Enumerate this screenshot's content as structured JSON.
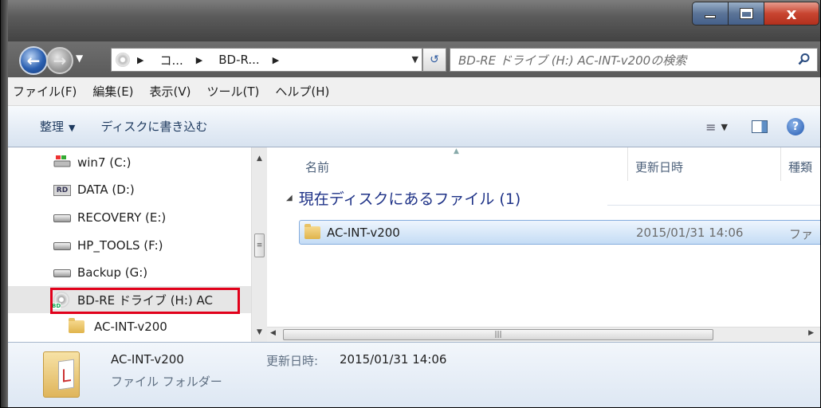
{
  "window": {
    "minimize_glyph": "—",
    "maximize_glyph": "□",
    "close_glyph": "x"
  },
  "address_bar": {
    "crumbs": [
      "コ...",
      "BD-R...",
      ""
    ],
    "search_placeholder": "BD-RE ドライブ (H:) AC-INT-v200の検索"
  },
  "menu": {
    "items": [
      "ファイル(F)",
      "編集(E)",
      "表示(V)",
      "ツール(T)",
      "ヘルプ(H)"
    ]
  },
  "toolbar": {
    "organize": "整理",
    "burn": "ディスクに書き込む"
  },
  "nav_tree": {
    "items": [
      {
        "label": "win7 (C:)",
        "icon": "windows-drive-icon"
      },
      {
        "label": "DATA (D:)",
        "icon": "data-drive-icon"
      },
      {
        "label": "RECOVERY (E:)",
        "icon": "hard-drive-icon"
      },
      {
        "label": "HP_TOOLS (F:)",
        "icon": "hard-drive-icon"
      },
      {
        "label": "Backup (G:)",
        "icon": "hard-drive-icon"
      },
      {
        "label": "BD-RE ドライブ (H:) AC",
        "icon": "bd-drive-icon",
        "selected": true
      },
      {
        "label": "AC-INT-v200",
        "icon": "folder-icon"
      }
    ]
  },
  "content": {
    "columns": {
      "name": "名前",
      "modified": "更新日時",
      "type": "種類"
    },
    "group_header": "現在ディスクにあるファイル (1)",
    "files": [
      {
        "name": "AC-INT-v200",
        "modified": "2015/01/31 14:06",
        "type": "ファ"
      }
    ]
  },
  "details": {
    "name": "AC-INT-v200",
    "type": "ファイル フォルダー",
    "modified_label": "更新日時:",
    "modified_value": "2015/01/31 14:06"
  },
  "colors": {
    "highlight": "#e1001a",
    "selection": "#c4dcf5",
    "group_header": "#1e3287"
  }
}
